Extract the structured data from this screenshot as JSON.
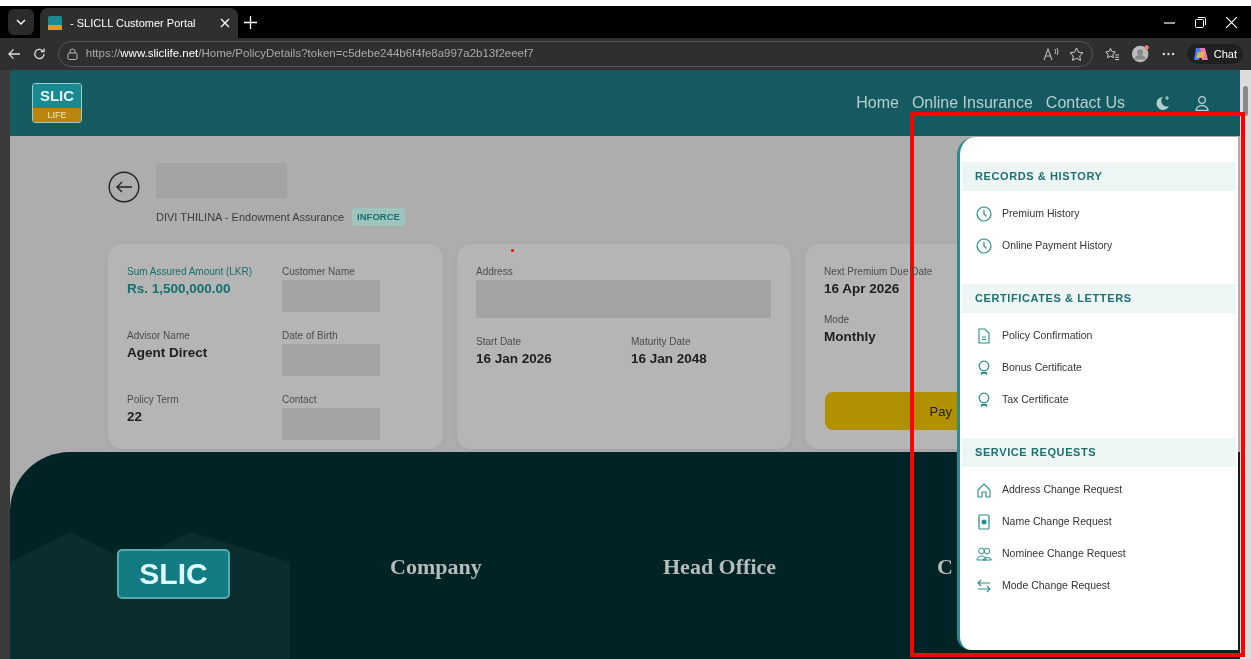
{
  "browser": {
    "tab_title": "- SLICLL Customer Portal",
    "url_scheme": "https://",
    "url_host": "www.sliclife.net",
    "url_path": "/Home/PolicyDetails?token=c5debe244b6f4fe8a997a2b13f2eeef7",
    "chat_label": "Chat"
  },
  "navbar": {
    "logo_top": "SLIC",
    "logo_bottom": "LIFE",
    "links": [
      "Home",
      "Online Insurance",
      "Contact Us"
    ]
  },
  "policy": {
    "subtitle": "DIVI THILINA - Endowment Assurance",
    "status": "INFORCE"
  },
  "cards": [
    {
      "fields": [
        {
          "kind": "amount",
          "label": "Sum Assured Amount (LKR)",
          "value": "Rs. 1,500,000.00"
        },
        {
          "kind": "redacted",
          "label": "Customer Name"
        },
        {
          "kind": "text",
          "label": "Advisor Name",
          "value": "Agent Direct"
        },
        {
          "kind": "redacted",
          "label": "Date of Birth"
        },
        {
          "kind": "text",
          "label": "Policy Term",
          "value": "22"
        },
        {
          "kind": "redacted",
          "label": "Contact"
        }
      ]
    },
    {
      "fields": [
        {
          "kind": "redacted_wide",
          "label": "Address"
        },
        {
          "kind": "text",
          "label": "Start Date",
          "value": "16 Jan 2026"
        },
        {
          "kind": "text",
          "label": "Maturity Date",
          "value": "16 Jan 2048"
        }
      ]
    },
    {
      "fields": [
        {
          "kind": "text",
          "label": "Next Premium Due Date",
          "value": "16 Apr 2026"
        },
        {
          "kind": "text",
          "label": "Mode",
          "value": "Monthly"
        }
      ],
      "button": "Pay"
    }
  ],
  "panel": {
    "sections": [
      {
        "title": "RECORDS & HISTORY",
        "items": [
          {
            "label": "Premium History"
          },
          {
            "label": "Online Payment History"
          }
        ]
      },
      {
        "title": "CERTIFICATES & LETTERS",
        "items": [
          {
            "label": "Policy Confirmation"
          },
          {
            "label": "Bonus Certificate"
          },
          {
            "label": "Tax Certificate"
          }
        ]
      },
      {
        "title": "SERVICE REQUESTS",
        "items": [
          {
            "label": "Address Change Request"
          },
          {
            "label": "Name Change Request"
          },
          {
            "label": "Nominee Change Request"
          },
          {
            "label": "Mode Change Request"
          }
        ]
      }
    ]
  },
  "footer": {
    "logo": "SLIC",
    "headings": [
      "Company",
      "Head Office",
      "C"
    ]
  }
}
